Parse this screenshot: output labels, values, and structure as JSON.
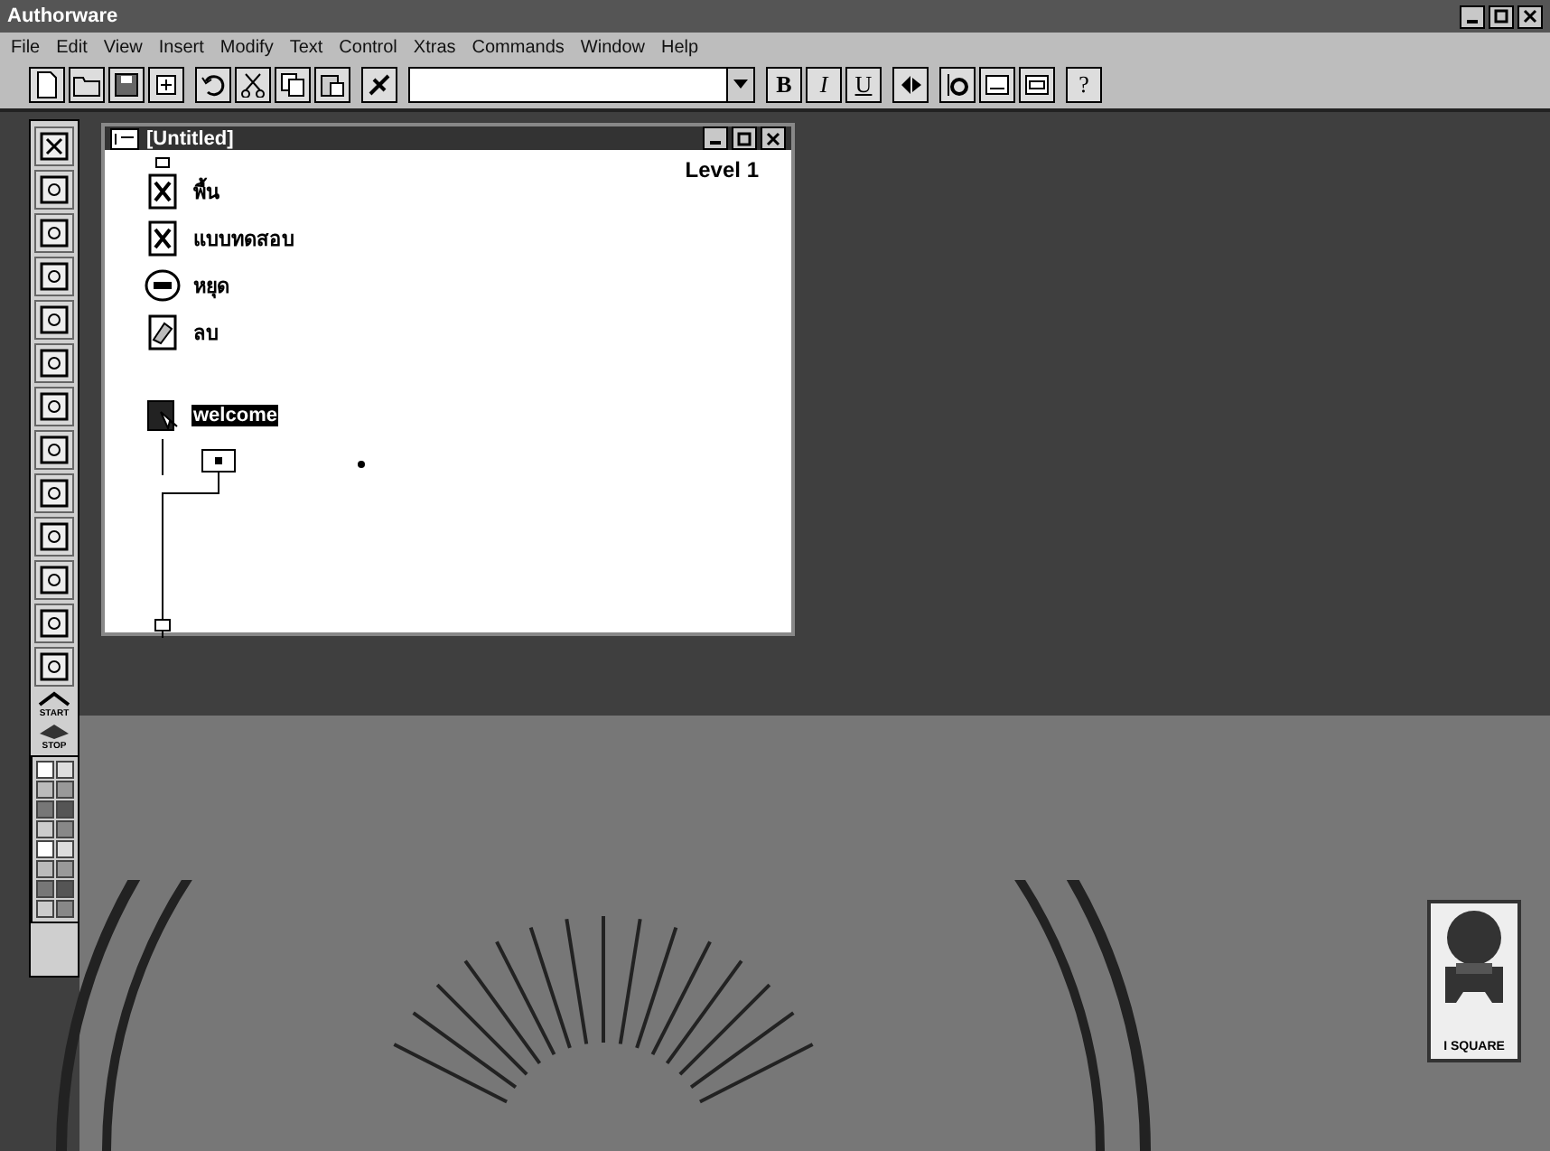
{
  "window": {
    "title": "Authorware"
  },
  "menu": [
    "File",
    "Edit",
    "View",
    "Insert",
    "Modify",
    "Text",
    "Control",
    "Xtras",
    "Commands",
    "Window",
    "Help"
  ],
  "toolbar": {
    "bold": "B",
    "italic": "I",
    "underline": "U",
    "help": "?"
  },
  "palette": {
    "start": "START",
    "stop": "STOP"
  },
  "flow_window": {
    "title": "[Untitled]",
    "level": "Level 1",
    "icons": [
      {
        "kind": "display",
        "label": "พื้น",
        "selected": false
      },
      {
        "kind": "display",
        "label": "แบบทดสอบ",
        "selected": false
      },
      {
        "kind": "wait",
        "label": "หยุด",
        "selected": false
      },
      {
        "kind": "erase",
        "label": "ลบ",
        "selected": false
      },
      {
        "kind": "interaction",
        "label": "welcome",
        "selected": true
      }
    ]
  },
  "logo": {
    "text": "I SQUARE"
  }
}
